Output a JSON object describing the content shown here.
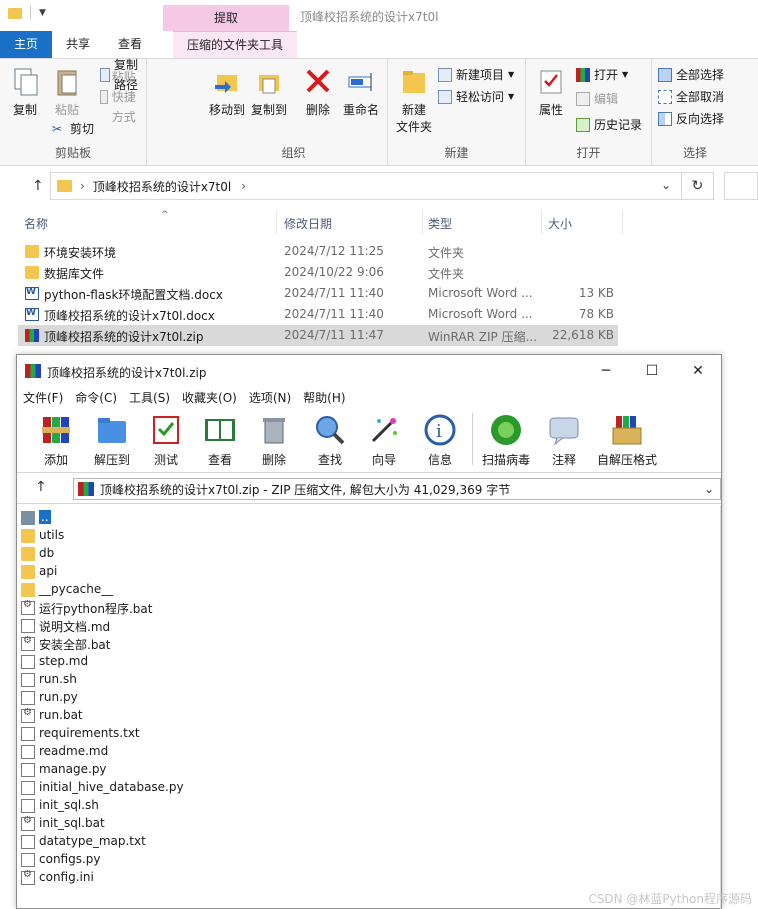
{
  "explorer": {
    "title": "顶峰校招系统的设计x7t0l",
    "context_tab_top": "提取",
    "tabs": [
      "主页",
      "共享",
      "查看",
      "压缩的文件夹工具"
    ],
    "ribbon": {
      "clipboard": {
        "label": "剪贴板",
        "copy": "复制",
        "paste": "粘贴",
        "copy_path": "复制路径",
        "paste_shortcut": "粘贴快捷方式",
        "cut": "剪切"
      },
      "organize": {
        "label": "组织",
        "move_to": "移动到",
        "copy_to": "复制到",
        "delete": "删除",
        "rename": "重命名"
      },
      "new": {
        "label": "新建",
        "new_folder": "新建\n文件夹",
        "new_item": "新建项目",
        "easy_access": "轻松访问"
      },
      "open": {
        "label": "打开",
        "properties": "属性",
        "open": "打开",
        "edit": "编辑",
        "history": "历史记录"
      },
      "select": {
        "label": "选择",
        "select_all": "全部选择",
        "select_none": "全部取消",
        "invert": "反向选择"
      }
    },
    "address": {
      "path": "顶峰校招系统的设计x7t0l"
    },
    "columns": {
      "name": "名称",
      "modified": "修改日期",
      "type": "类型",
      "size": "大小"
    },
    "files": [
      {
        "name": "环境安装环境",
        "date": "2024/7/12 11:25",
        "type": "文件夹",
        "size": "",
        "icon": "folder-icon"
      },
      {
        "name": "数据库文件",
        "date": "2024/10/22 9:06",
        "type": "文件夹",
        "size": "",
        "icon": "folder-icon"
      },
      {
        "name": "python-flask环境配置文档.docx",
        "date": "2024/7/11 11:40",
        "type": "Microsoft Word ...",
        "size": "13 KB",
        "icon": "word-icon"
      },
      {
        "name": "顶峰校招系统的设计x7t0l.docx",
        "date": "2024/7/11 11:40",
        "type": "Microsoft Word ...",
        "size": "78 KB",
        "icon": "word-icon"
      },
      {
        "name": "顶峰校招系统的设计x7t0l.zip",
        "date": "2024/7/11 11:47",
        "type": "WinRAR ZIP 压缩...",
        "size": "22,618 KB",
        "icon": "zip-icon"
      }
    ]
  },
  "winrar": {
    "title": "顶峰校招系统的设计x7t0l.zip",
    "menu": [
      "文件(F)",
      "命令(C)",
      "工具(S)",
      "收藏夹(O)",
      "选项(N)",
      "帮助(H)"
    ],
    "toolbar": [
      "添加",
      "解压到",
      "测试",
      "查看",
      "删除",
      "查找",
      "向导",
      "信息",
      "扫描病毒",
      "注释",
      "自解压格式"
    ],
    "path_text": "顶峰校招系统的设计x7t0l.zip - ZIP 压缩文件, 解包大小为 41,029,369 字节",
    "entries": [
      {
        "name": "..",
        "icon": "parent-icon"
      },
      {
        "name": "utils",
        "icon": "folder-icon"
      },
      {
        "name": "db",
        "icon": "folder-icon"
      },
      {
        "name": "api",
        "icon": "folder-icon"
      },
      {
        "name": "__pycache__",
        "icon": "folder-icon"
      },
      {
        "name": "运行python程序.bat",
        "icon": "bat-icon"
      },
      {
        "name": "说明文档.md",
        "icon": "doc-icon"
      },
      {
        "name": "安装全部.bat",
        "icon": "bat-icon"
      },
      {
        "name": "step.md",
        "icon": "doc-icon"
      },
      {
        "name": "run.sh",
        "icon": "doc-icon"
      },
      {
        "name": "run.py",
        "icon": "doc-icon"
      },
      {
        "name": "run.bat",
        "icon": "bat-icon"
      },
      {
        "name": "requirements.txt",
        "icon": "doc-icon"
      },
      {
        "name": "readme.md",
        "icon": "doc-icon"
      },
      {
        "name": "manage.py",
        "icon": "doc-icon"
      },
      {
        "name": "initial_hive_database.py",
        "icon": "doc-icon"
      },
      {
        "name": "init_sql.sh",
        "icon": "doc-icon"
      },
      {
        "name": "init_sql.bat",
        "icon": "bat-icon"
      },
      {
        "name": "datatype_map.txt",
        "icon": "doc-icon"
      },
      {
        "name": "configs.py",
        "icon": "doc-icon"
      },
      {
        "name": "config.ini",
        "icon": "bat-icon"
      }
    ]
  },
  "watermark": "CSDN @林蓝Python程序源码"
}
